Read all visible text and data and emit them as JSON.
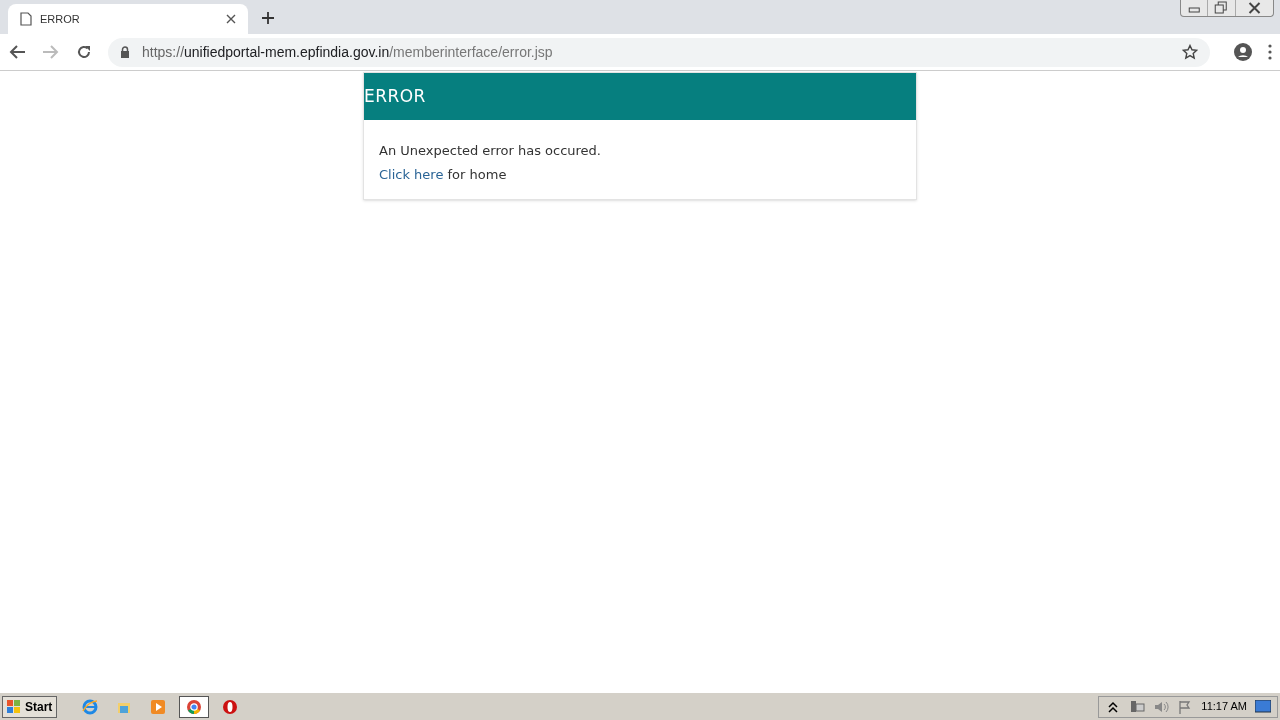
{
  "browser": {
    "tab_title": "ERROR",
    "url": {
      "scheme": "https://",
      "host": "unifiedportal-mem.epfindia.gov.in",
      "path": "/memberinterface/error.jsp"
    }
  },
  "card": {
    "title": "ERROR",
    "message": "An Unexpected error has occured.",
    "link": "Click here",
    "link_suffix": "for home"
  },
  "taskbar": {
    "start": "Start",
    "apps": [
      {
        "kind": "ie",
        "selected": false
      },
      {
        "kind": "folder",
        "selected": false
      },
      {
        "kind": "media",
        "selected": false
      },
      {
        "kind": "chrome",
        "selected": true
      },
      {
        "kind": "opera",
        "selected": false
      }
    ],
    "clock": "11:17 AM"
  }
}
